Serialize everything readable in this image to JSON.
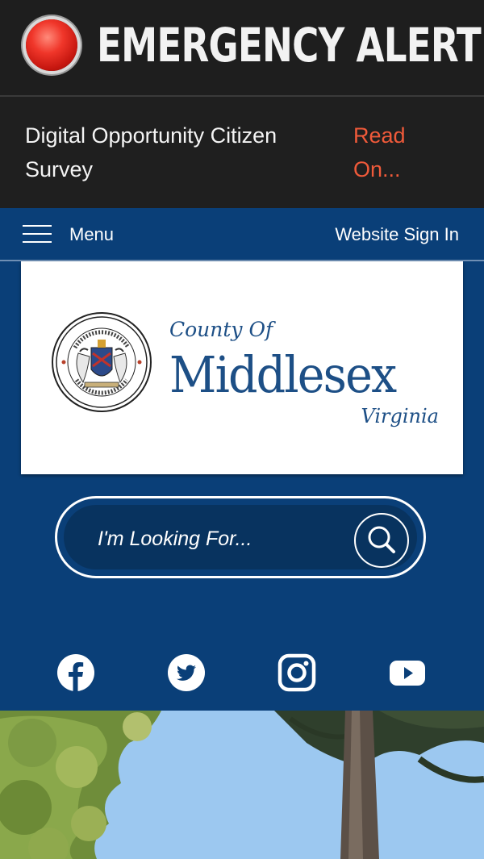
{
  "alert": {
    "title": "EMERGENCY ALERT",
    "light_icon": "red-alert-light-icon"
  },
  "ticker": {
    "message": "Digital Opportunity Citizen Survey",
    "link_label": "Read On..."
  },
  "nav": {
    "menu_label": "Menu",
    "sign_in_label": "Website Sign In"
  },
  "logo": {
    "county_of": "County Of",
    "name": "Middlesex",
    "state": "Virginia"
  },
  "search": {
    "placeholder": "I'm Looking For..."
  },
  "social": [
    "facebook-icon",
    "twitter-icon",
    "instagram-icon",
    "youtube-icon"
  ],
  "colors": {
    "alert_bg": "#1e1e1e",
    "link_accent": "#f05a3a",
    "brand_blue": "#0a3f78",
    "logo_blue": "#1d4f86"
  }
}
